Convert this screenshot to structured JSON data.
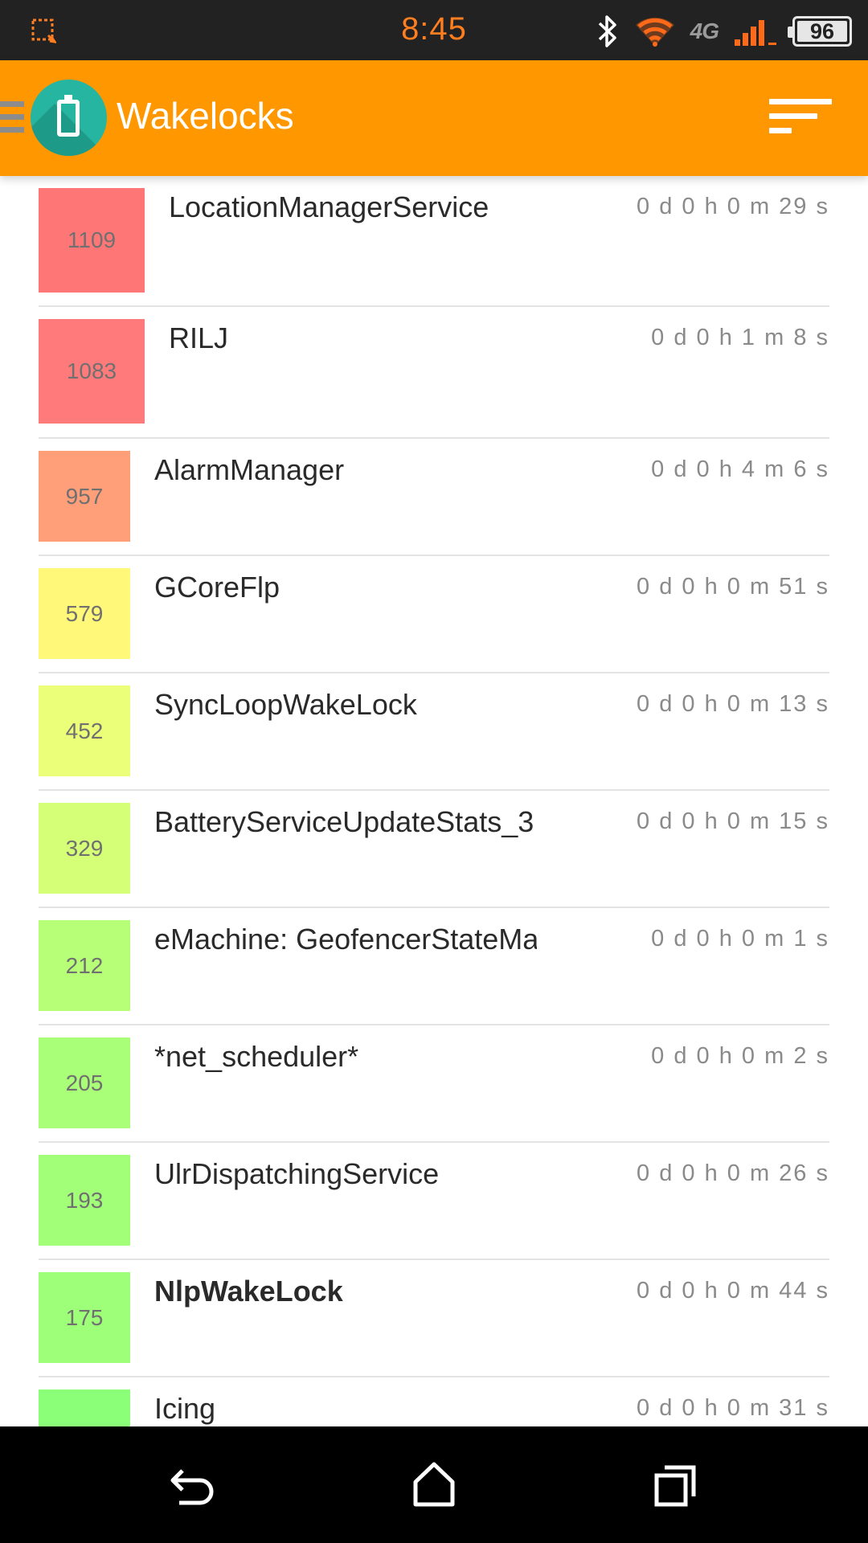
{
  "status_bar": {
    "time": "8:45",
    "network": "4G",
    "battery": "96",
    "icons": [
      "screenshot-icon",
      "bluetooth-icon",
      "wifi-icon",
      "lte-icon",
      "signal-icon",
      "battery-icon"
    ]
  },
  "app_bar": {
    "title": "Wakelocks",
    "icons": [
      "menu-icon",
      "app-logo-icon",
      "sort-icon"
    ]
  },
  "wakelocks": [
    {
      "count": "1109",
      "name": "LocationManagerService",
      "time": "0 d 0 h 0 m 29 s",
      "color": "#ff7676"
    },
    {
      "count": "1083",
      "name": "RILJ",
      "time": "0 d 0 h 1 m 8 s",
      "color": "#ff7a7a"
    },
    {
      "count": "957",
      "name": "AlarmManager",
      "time": "0 d 0 h 4 m 6 s",
      "color": "#ff9f7a"
    },
    {
      "count": "579",
      "name": "GCoreFlp",
      "time": "0 d 0 h 0 m 51 s",
      "color": "#fff878"
    },
    {
      "count": "452",
      "name": "SyncLoopWakeLock",
      "time": "0 d 0 h 0 m 13 s",
      "color": "#ecff78"
    },
    {
      "count": "329",
      "name": "BatteryServiceUpdateStats_3",
      "time": "0 d 0 h 0 m 15 s",
      "color": "#d6ff78"
    },
    {
      "count": "212",
      "name": "eMachine: GeofencerStateMachine",
      "time": "0 d 0 h 0 m 1 s",
      "color": "#b8ff78"
    },
    {
      "count": "205",
      "name": "*net_scheduler*",
      "time": "0 d 0 h 0 m 2 s",
      "color": "#aaff78"
    },
    {
      "count": "193",
      "name": "UlrDispatchingService",
      "time": "0 d 0 h 0 m 26 s",
      "color": "#a2ff78"
    },
    {
      "count": "175",
      "name": "NlpWakeLock",
      "time": "0 d 0 h 0 m 44 s",
      "color": "#9eff78"
    },
    {
      "count": "",
      "name": "Icing",
      "time": "0 d 0 h 0 m 31 s",
      "color": "#8cff78"
    }
  ],
  "nav_bar": {
    "icons": [
      "back-icon",
      "home-icon",
      "recents-icon"
    ]
  }
}
